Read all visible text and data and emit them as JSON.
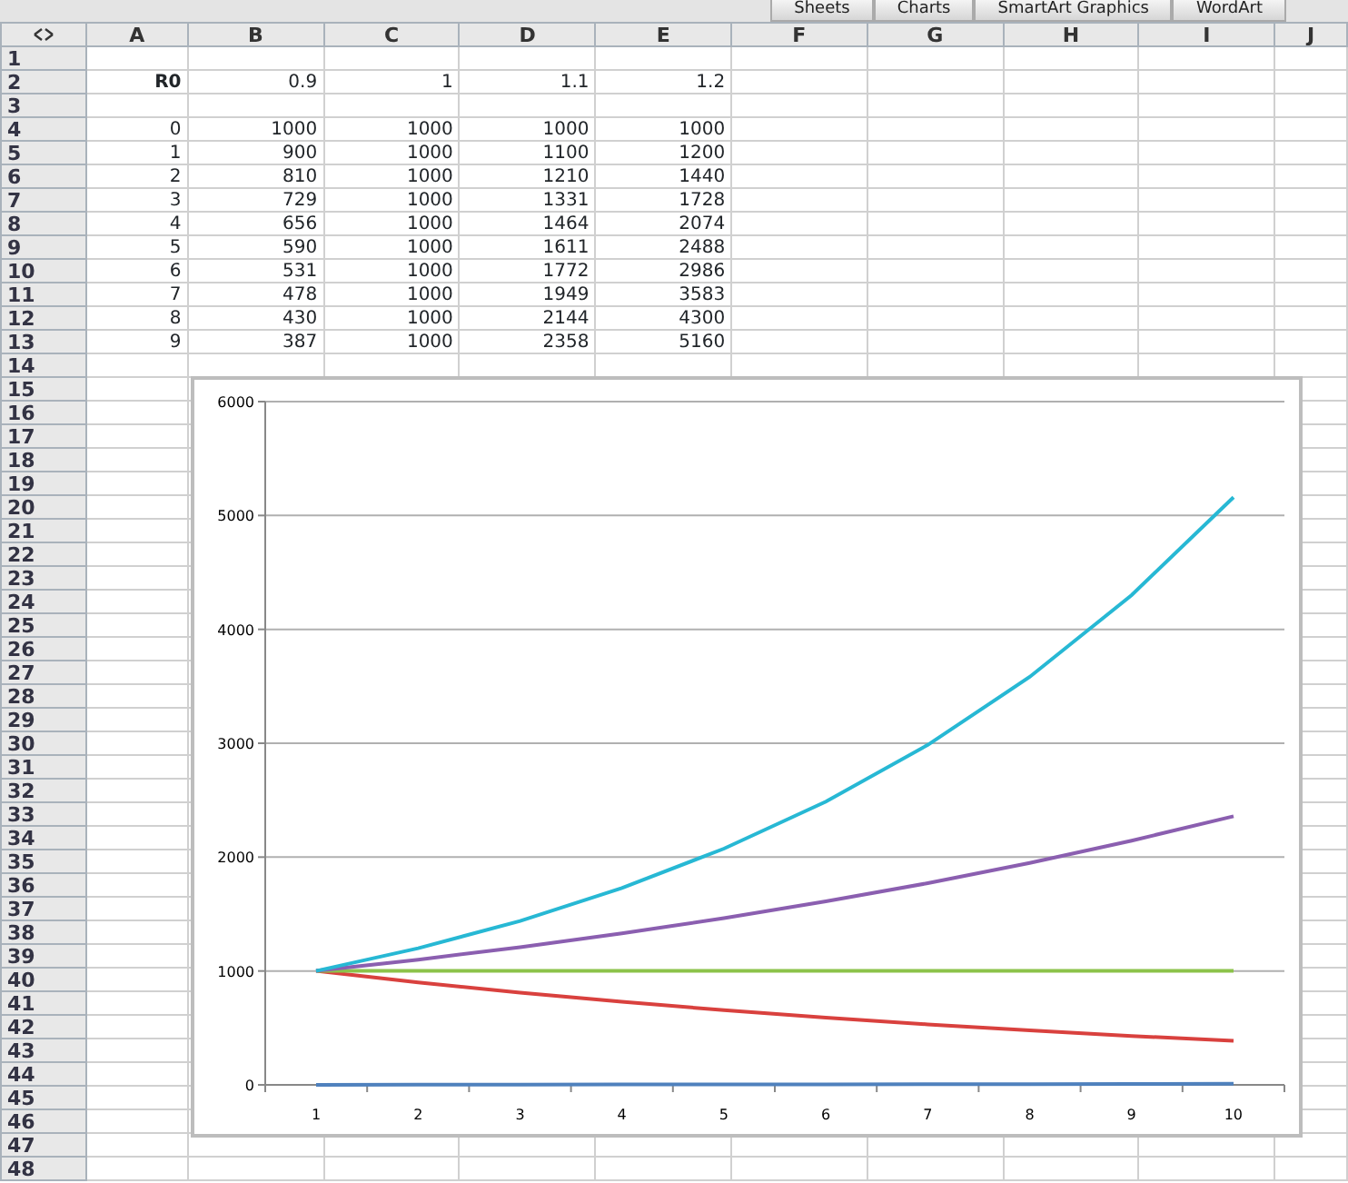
{
  "ribbon_tabs": [
    "Sheets",
    "Charts",
    "SmartArt Graphics",
    "WordArt"
  ],
  "columns": [
    "A",
    "B",
    "C",
    "D",
    "E",
    "F",
    "G",
    "H",
    "I",
    "J"
  ],
  "rows": [
    {
      "number": "1",
      "cells": []
    },
    {
      "number": "2",
      "kind": "header",
      "cells": [
        "R0",
        "0.9",
        "1",
        "1.1",
        "1.2"
      ]
    },
    {
      "number": "3",
      "cells": []
    },
    {
      "number": "4",
      "cells": [
        "0",
        "1000",
        "1000",
        "1000",
        "1000"
      ]
    },
    {
      "number": "5",
      "cells": [
        "1",
        "900",
        "1000",
        "1100",
        "1200"
      ]
    },
    {
      "number": "6",
      "cells": [
        "2",
        "810",
        "1000",
        "1210",
        "1440"
      ]
    },
    {
      "number": "7",
      "cells": [
        "3",
        "729",
        "1000",
        "1331",
        "1728"
      ]
    },
    {
      "number": "8",
      "cells": [
        "4",
        "656",
        "1000",
        "1464",
        "2074"
      ]
    },
    {
      "number": "9",
      "cells": [
        "5",
        "590",
        "1000",
        "1611",
        "2488"
      ]
    },
    {
      "number": "10",
      "cells": [
        "6",
        "531",
        "1000",
        "1772",
        "2986"
      ]
    },
    {
      "number": "11",
      "cells": [
        "7",
        "478",
        "1000",
        "1949",
        "3583"
      ]
    },
    {
      "number": "12",
      "cells": [
        "8",
        "430",
        "1000",
        "2144",
        "4300"
      ]
    },
    {
      "number": "13",
      "cells": [
        "9",
        "387",
        "1000",
        "2358",
        "5160"
      ]
    },
    {
      "number": "14",
      "cells": []
    },
    {
      "number": "15",
      "cells": []
    },
    {
      "number": "16",
      "cells": []
    },
    {
      "number": "17",
      "cells": []
    },
    {
      "number": "18",
      "cells": []
    },
    {
      "number": "19",
      "cells": []
    },
    {
      "number": "20",
      "cells": []
    },
    {
      "number": "21",
      "cells": []
    },
    {
      "number": "22",
      "cells": []
    },
    {
      "number": "23",
      "cells": []
    },
    {
      "number": "24",
      "cells": []
    },
    {
      "number": "25",
      "cells": []
    },
    {
      "number": "26",
      "cells": []
    },
    {
      "number": "27",
      "cells": []
    },
    {
      "number": "28",
      "cells": []
    },
    {
      "number": "29",
      "cells": []
    },
    {
      "number": "30",
      "cells": []
    },
    {
      "number": "31",
      "cells": []
    },
    {
      "number": "32",
      "cells": []
    },
    {
      "number": "33",
      "cells": []
    },
    {
      "number": "34",
      "cells": []
    },
    {
      "number": "35",
      "cells": []
    },
    {
      "number": "36",
      "cells": []
    },
    {
      "number": "37",
      "cells": []
    },
    {
      "number": "38",
      "cells": []
    },
    {
      "number": "39",
      "cells": []
    },
    {
      "number": "40",
      "cells": []
    },
    {
      "number": "41",
      "cells": []
    },
    {
      "number": "42",
      "cells": []
    },
    {
      "number": "43",
      "cells": []
    },
    {
      "number": "44",
      "cells": []
    },
    {
      "number": "45",
      "cells": []
    },
    {
      "number": "46",
      "cells": []
    },
    {
      "number": "47",
      "cells": []
    },
    {
      "number": "48",
      "cells": []
    }
  ],
  "chart": {
    "chart_data": {
      "type": "line",
      "grid": true,
      "categories": [
        "1",
        "2",
        "3",
        "4",
        "5",
        "6",
        "7",
        "8",
        "9",
        "10"
      ],
      "ylim": [
        0,
        6000
      ],
      "yticks": [
        0,
        1000,
        2000,
        3000,
        4000,
        5000,
        6000
      ],
      "series": [
        {
          "color": "#4f81bd",
          "values": [
            0,
            1,
            2,
            3,
            4,
            5,
            6,
            7,
            8,
            9
          ]
        },
        {
          "color": "#d9413e",
          "values": [
            1000,
            900,
            810,
            729,
            656,
            590,
            531,
            478,
            430,
            387
          ]
        },
        {
          "color": "#8cc34a",
          "values": [
            1000,
            1000,
            1000,
            1000,
            1000,
            1000,
            1000,
            1000,
            1000,
            1000
          ]
        },
        {
          "color": "#8b5fb0",
          "values": [
            1000,
            1100,
            1210,
            1331,
            1464,
            1611,
            1772,
            1949,
            2144,
            2358
          ]
        },
        {
          "color": "#27b8d4",
          "values": [
            1000,
            1200,
            1440,
            1728,
            2074,
            2488,
            2986,
            3583,
            4300,
            5160
          ]
        }
      ]
    }
  }
}
